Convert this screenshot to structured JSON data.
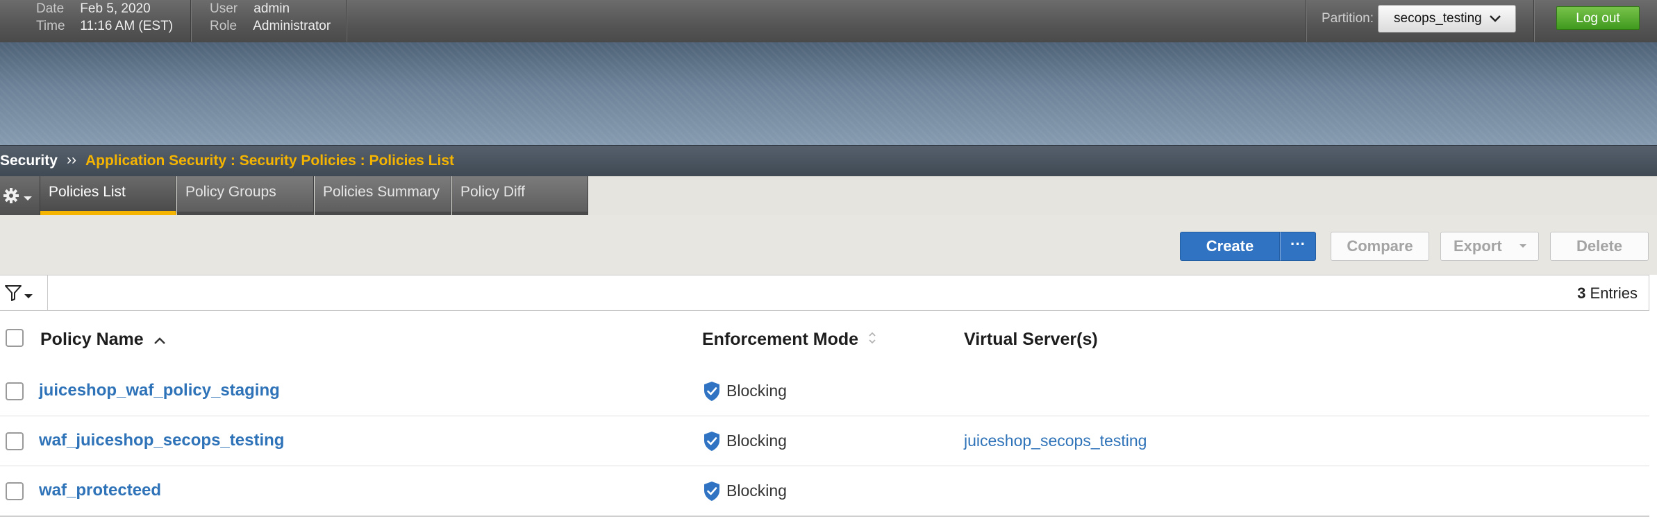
{
  "topbar": {
    "date_label": "Date",
    "date_value": "Feb 5, 2020",
    "time_label": "Time",
    "time_value": "11:16 AM (EST)",
    "user_label": "User",
    "user_value": "admin",
    "role_label": "Role",
    "role_value": "Administrator",
    "partition_label": "Partition:",
    "partition_value": "secops_testing",
    "logout_label": "Log out"
  },
  "breadcrumb": {
    "root": "Security",
    "separator": "››",
    "path": "Application Security : Security Policies : Policies List"
  },
  "tabs": [
    {
      "label": "Policies List",
      "active": true
    },
    {
      "label": "Policy Groups",
      "active": false
    },
    {
      "label": "Policies Summary",
      "active": false
    },
    {
      "label": "Policy Diff",
      "active": false
    }
  ],
  "toolbar": {
    "create_label": "Create",
    "more_label": "···",
    "compare_label": "Compare",
    "export_label": "Export",
    "delete_label": "Delete"
  },
  "filter": {
    "entries_count": "3",
    "entries_label": "Entries"
  },
  "table": {
    "columns": [
      "Policy Name",
      "Enforcement Mode",
      "Virtual Server(s)"
    ],
    "rows": [
      {
        "policy_name": "juiceshop_waf_policy_staging",
        "enforcement_mode": "Blocking",
        "virtual_servers": ""
      },
      {
        "policy_name": "waf_juiceshop_secops_testing",
        "enforcement_mode": "Blocking",
        "virtual_servers": "juiceshop_secops_testing"
      },
      {
        "policy_name": "waf_protecteed",
        "enforcement_mode": "Blocking",
        "virtual_servers": ""
      }
    ]
  },
  "colors": {
    "accent_yellow": "#f5b400",
    "primary_blue": "#2f73c2",
    "link_blue": "#2e72b8",
    "logout_green": "#4faa28"
  },
  "icons": [
    "gear-icon",
    "caret-down-icon",
    "chevron-down-icon",
    "filter-icon",
    "sort-ascending-icon",
    "sort-both-icon",
    "shield-check-icon"
  ]
}
